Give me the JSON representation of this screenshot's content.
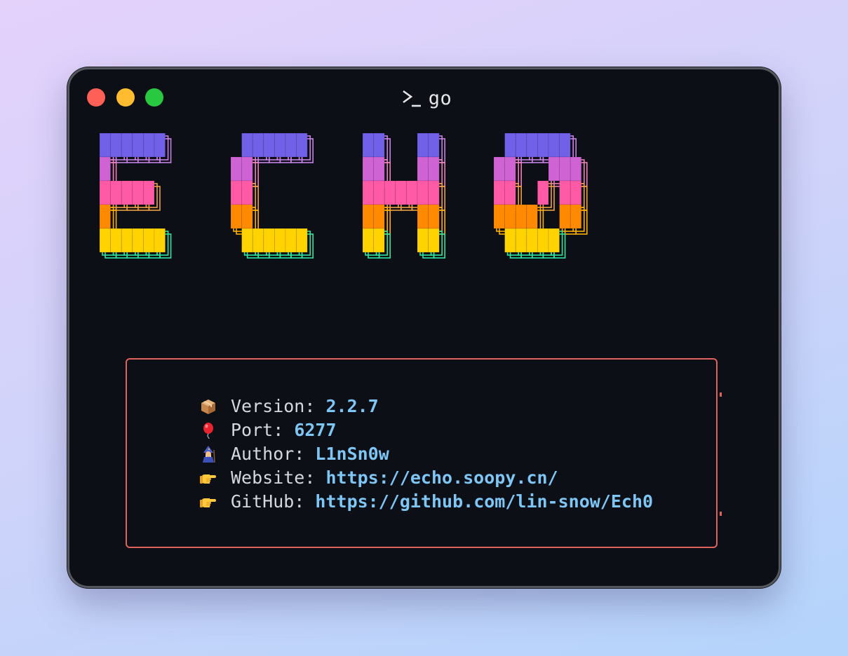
{
  "window": {
    "title": "go",
    "prompt_icon": "terminal-prompt-icon",
    "controls": [
      {
        "name": "close",
        "color": "#fe5f57"
      },
      {
        "name": "minimize",
        "color": "#febc2e"
      },
      {
        "name": "zoom",
        "color": "#28c840"
      }
    ]
  },
  "logo": {
    "text": "ECH0",
    "stripe_colors": [
      "#7160e8",
      "#d063d4",
      "#ff5aa6",
      "#ff8a00",
      "#ffd300"
    ],
    "shadow_colors": [
      "#c980e6",
      "#f080b8",
      "#f0a040",
      "#ffb000",
      "#2ee59d"
    ]
  },
  "info": {
    "border_color": "#e0625c",
    "value_color": "#7dc6f5",
    "lines": [
      {
        "icon": "package-icon",
        "label": "Version: ",
        "value": "2.2.7"
      },
      {
        "icon": "balloon-icon",
        "label": "Port: ",
        "value": "6277"
      },
      {
        "icon": "mage-icon",
        "label": "Author: ",
        "value": "L1nSn0w"
      },
      {
        "icon": "pointing-hand-icon",
        "label": "Website: ",
        "value": "https://echo.soopy.cn/"
      },
      {
        "icon": "pointing-hand-icon",
        "label": "GitHub: ",
        "value": "https://github.com/lin-snow/Ech0"
      }
    ]
  }
}
